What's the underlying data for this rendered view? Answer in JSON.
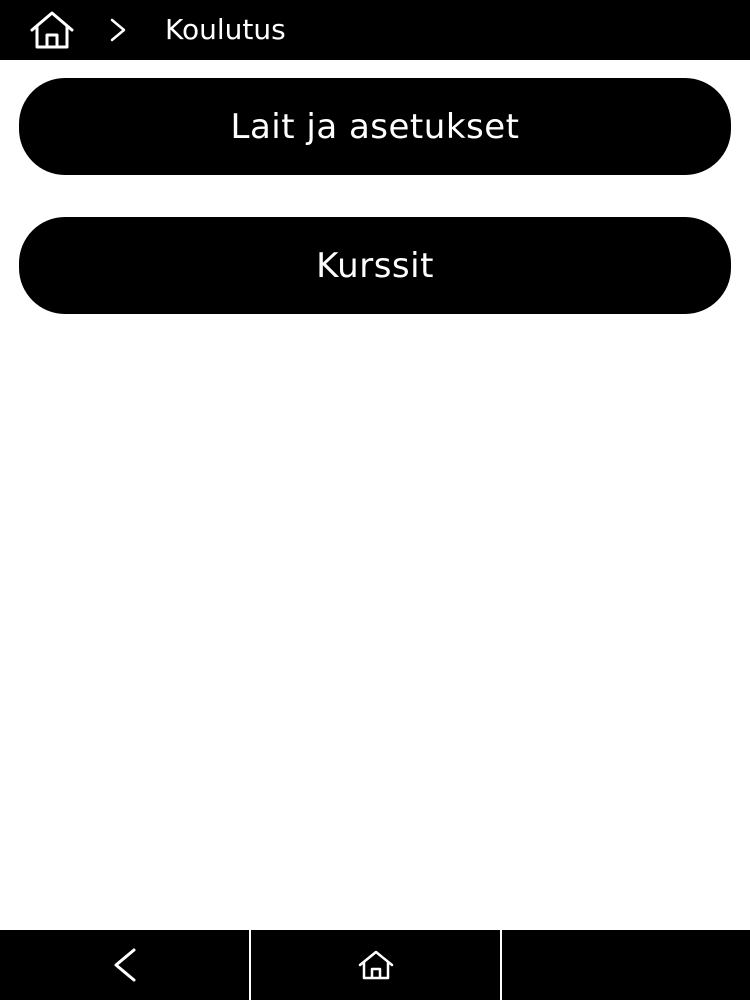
{
  "header": {
    "breadcrumb_separator": ">",
    "title": "Koulutus",
    "home_icon": "home-icon"
  },
  "menu": {
    "items": [
      {
        "label": "Lait ja asetukset"
      },
      {
        "label": "Kurssit"
      }
    ]
  },
  "bottom_nav": {
    "back_icon": "chevron-left-icon",
    "home_icon": "home-icon"
  },
  "colors": {
    "bar_background": "#000000",
    "page_background": "#ffffff",
    "text_on_dark": "#ffffff"
  }
}
